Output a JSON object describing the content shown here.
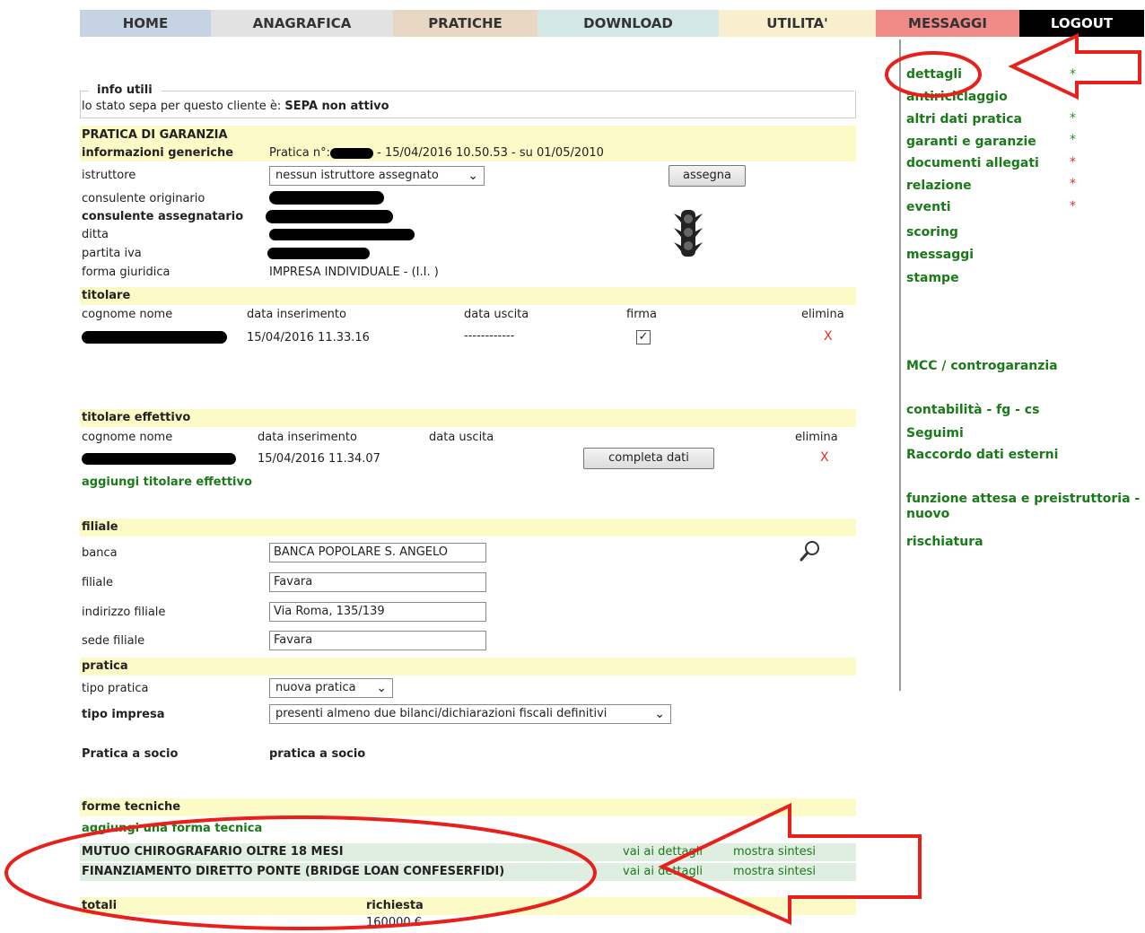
{
  "nav": {
    "home": "HOME",
    "anagrafica": "ANAGRAFICA",
    "pratiche": "PRATICHE",
    "download": "DOWNLOAD",
    "utilita": "UTILITA'",
    "messaggi": "MESSAGGI",
    "logout": "LOGOUT"
  },
  "info": {
    "legend": "info utili",
    "sepa_text": "lo stato sepa per questo cliente è:",
    "sepa_value": "SEPA non attivo"
  },
  "pratica": {
    "heading": "PRATICA DI GARANZIA",
    "subheading": "informazioni generiche",
    "number_prefix": "Pratica n°:",
    "number_suffix": "- 15/04/2016 10.50.53 - su 01/05/2010",
    "istruttore_label": "istruttore",
    "istruttore_value": "nessun istruttore assegnato",
    "assegna": "assegna",
    "consulente_originario": "consulente originario",
    "consulente_assegnatario": "consulente assegnatario",
    "ditta": "ditta",
    "partita_iva": "partita iva",
    "forma_giuridica_label": "forma giuridica",
    "forma_giuridica_value": "IMPRESA INDIVIDUALE - (I.I. )"
  },
  "titolare": {
    "heading": "titolare",
    "cols": [
      "cognome nome",
      "data inserimento",
      "data uscita",
      "firma",
      "elimina"
    ],
    "date": "15/04/2016 11.33.16",
    "uscita": "------------",
    "delete": "X"
  },
  "titolare_effettivo": {
    "heading": "titolare effettivo",
    "cols": [
      "cognome nome",
      "data inserimento",
      "data uscita",
      "elimina"
    ],
    "date": "15/04/2016 11.34.07",
    "completa": "completa dati",
    "delete": "X",
    "add": "aggiungi titolare effettivo"
  },
  "filiale": {
    "heading": "filiale",
    "banca_label": "banca",
    "banca_value": "BANCA POPOLARE S. ANGELO",
    "filiale_label": "filiale",
    "filiale_value": "Favara",
    "indirizzo_label": "indirizzo filiale",
    "indirizzo_value": "Via Roma, 135/139",
    "sede_label": "sede filiale",
    "sede_value": "Favara"
  },
  "pratica2": {
    "heading": "pratica",
    "tipo_pratica_label": "tipo pratica",
    "tipo_pratica_value": "nuova pratica",
    "tipo_impresa_label": "tipo impresa",
    "tipo_impresa_value": "presenti almeno due bilanci/dichiarazioni fiscali definitivi",
    "socio_label": "Pratica a socio",
    "socio_value": "pratica a socio"
  },
  "forme": {
    "heading": "forme tecniche",
    "add": "aggiungi una forma tecnica",
    "rows": [
      {
        "name": "MUTUO CHIROGRAFARIO OLTRE 18 MESI",
        "details": "vai ai dettagli",
        "sintesi": "mostra sintesi"
      },
      {
        "name": "FINANZIAMENTO DIRETTO PONTE (BRIDGE LOAN CONFESERFIDI)",
        "details": "vai ai dettagli",
        "sintesi": "mostra sintesi"
      }
    ]
  },
  "totali": {
    "label": "totali",
    "richiesta_label": "richiesta",
    "richiesta_value": "160000 €"
  },
  "sidebar": {
    "items": [
      {
        "label": "dettagli",
        "star": "*",
        "star_color": "#1a9a1a"
      },
      {
        "label": "antiriciclaggio",
        "star": "",
        "star_color": ""
      },
      {
        "label": "altri dati pratica",
        "star": "*",
        "star_color": "#1a9a1a"
      },
      {
        "label": "garanti e garanzie",
        "star": "*",
        "star_color": "#1a9a1a"
      },
      {
        "label": "documenti allegati",
        "star": "*",
        "star_color": "#e0302a"
      },
      {
        "label": "relazione",
        "star": "*",
        "star_color": "#e0302a"
      },
      {
        "label": "eventi",
        "star": "*",
        "star_color": "#e0302a"
      },
      {
        "label": "scoring"
      },
      {
        "label": "messaggi"
      },
      {
        "label": "stampe"
      },
      {
        "label": "MCC / controgaranzia"
      },
      {
        "label": "contabilità - fg - cs"
      },
      {
        "label": "Seguimi"
      },
      {
        "label": "Raccordo dati esterni"
      },
      {
        "label": "funzione attesa e preistruttoria - nuovo"
      },
      {
        "label": "rischiatura"
      }
    ]
  },
  "colors": {
    "accent_green": "#1a7a1a",
    "band_yellow": "#fcfac6",
    "row_green": "#dfeee0",
    "annotation_red": "#e8201c"
  }
}
